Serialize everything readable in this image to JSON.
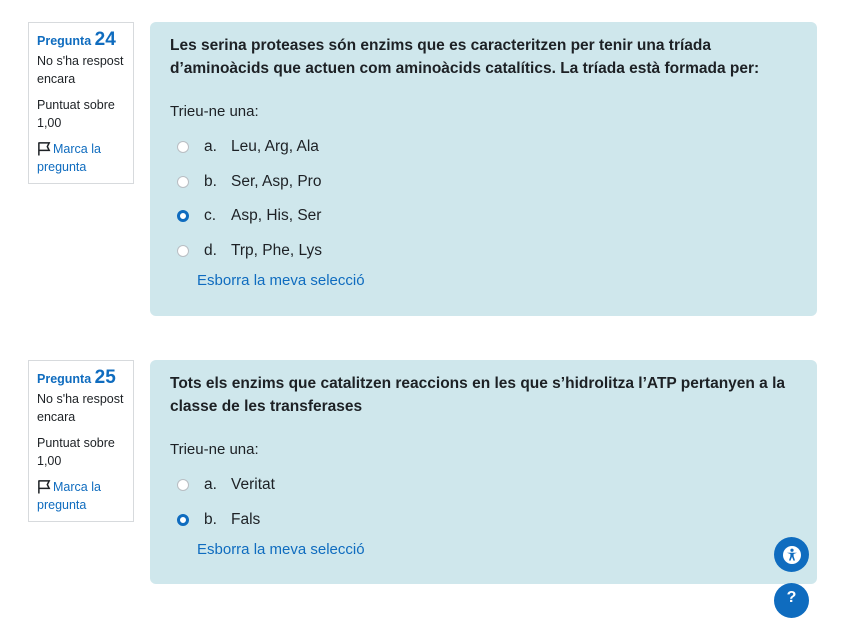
{
  "questions": [
    {
      "label": "Pregunta",
      "number": "24",
      "state": "No s'ha respost encara",
      "grade": "Puntuat sobre 1,00",
      "flag_label": "Marca la pregunta",
      "text": "Les serina proteases són enzims que es caracteritzen per tenir una tríada d’aminoàcids que actuen com aminoàcids catalítics. La tríada està formada per:",
      "prompt": "Trieu-ne una:",
      "options": [
        {
          "letter": "a.",
          "text": "Leu, Arg, Ala",
          "selected": false
        },
        {
          "letter": "b.",
          "text": "Ser, Asp, Pro",
          "selected": false
        },
        {
          "letter": "c.",
          "text": "Asp, His, Ser",
          "selected": true
        },
        {
          "letter": "d.",
          "text": "Trp, Phe, Lys",
          "selected": false
        }
      ],
      "clear_label": "Esborra la meva selecció"
    },
    {
      "label": "Pregunta",
      "number": "25",
      "state": "No s'ha respost encara",
      "grade": "Puntuat sobre 1,00",
      "flag_label": "Marca la pregunta",
      "text": "Tots els enzims que catalitzen reaccions en les que s’hidrolitza l’ATP pertanyen a la classe de les transferases",
      "prompt": "Trieu-ne una:",
      "options": [
        {
          "letter": "a.",
          "text": "Veritat",
          "selected": false
        },
        {
          "letter": "b.",
          "text": "Fals",
          "selected": true
        }
      ],
      "clear_label": "Esborra la meva selecció"
    }
  ],
  "floating": {
    "accessibility_icon": "accessibility-icon",
    "help_label": "?"
  },
  "colors": {
    "accent": "#0f6cbf",
    "question_bg": "#cfe7ec"
  }
}
